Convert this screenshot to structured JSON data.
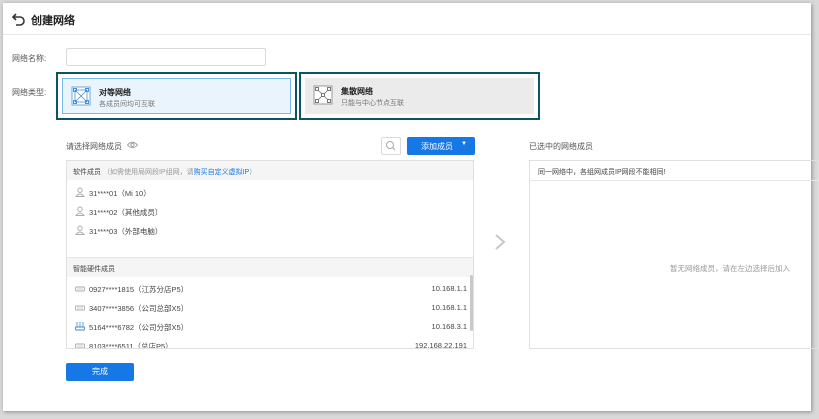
{
  "header": {
    "title": "创建网络",
    "back_icon": "back-arrow-icon"
  },
  "form": {
    "name_label": "网络名称:",
    "name_value": "",
    "type_label": "网络类型:",
    "types": [
      {
        "title": "对等网络",
        "desc": "各成员间均可互联",
        "selected": true,
        "icon": "mesh-network-icon"
      },
      {
        "title": "集散网络",
        "desc": "只能与中心节点互联",
        "selected": false,
        "icon": "hub-network-icon"
      }
    ]
  },
  "left": {
    "title": "请选择网络成员",
    "add_button": "添加成员",
    "software": {
      "head": "软件成员",
      "note": "（如需使用局网段IP组网，请",
      "link": "购买自定义虚拟IP",
      "note_end": "）",
      "rows": [
        {
          "text": "31****01（Mi 10）"
        },
        {
          "text": "31****02（其他成员）"
        },
        {
          "text": "31****03（外部电脑）"
        }
      ]
    },
    "hardware": {
      "head": "智能硬件成员",
      "rows": [
        {
          "text": "0927****1815（江苏分店P5）",
          "ip": "10.168.1.1"
        },
        {
          "text": "3407****3856（公司总部X5）",
          "ip": "10.168.1.1"
        },
        {
          "text": "5164****6782（公司分部X5）",
          "ip": "10.168.3.1"
        },
        {
          "text": "8103****6511（总店P5）",
          "ip": "192.168.22.191"
        }
      ]
    }
  },
  "right": {
    "title": "已选中的网络成员",
    "note": "同一网络中，各组网成员IP网段不能相同!",
    "empty": "暂无网络成员，请在左边选择后加入"
  },
  "footer": {
    "done": "完成"
  },
  "colors": {
    "primary": "#1677e6",
    "card_border": "#0b5563"
  }
}
